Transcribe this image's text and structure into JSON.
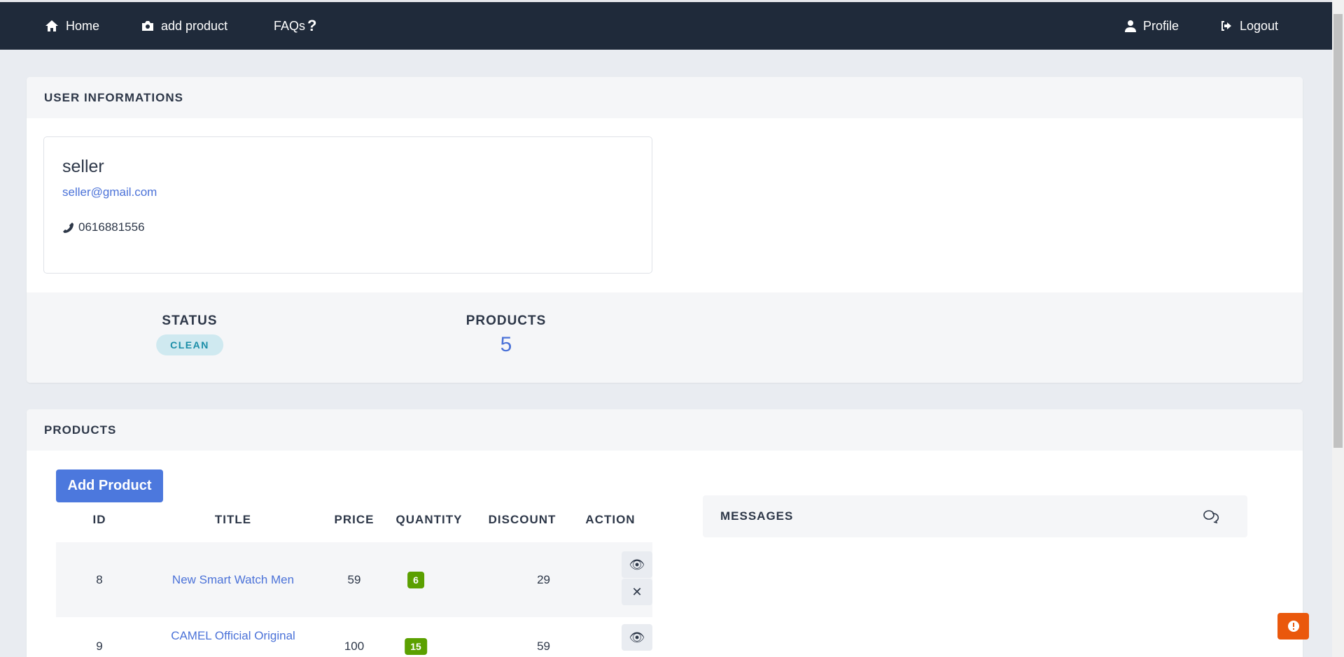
{
  "nav": {
    "home": "Home",
    "add_product": "add product",
    "faqs": "FAQs",
    "profile": "Profile",
    "logout": "Logout"
  },
  "user_card": {
    "title": "USER INFORMATIONS",
    "name": "seller",
    "email": "seller@gmail.com",
    "phone": "0616881556",
    "status_label": "STATUS",
    "status_value": "CLEAN",
    "products_label": "PRODUCTS",
    "products_count": "5"
  },
  "products_card": {
    "title": "PRODUCTS",
    "add_button": "Add Product",
    "columns": [
      "ID",
      "TITLE",
      "PRICE",
      "QUANTITY",
      "DISCOUNT",
      "ACTION"
    ],
    "rows": [
      {
        "id": "8",
        "title": "New Smart Watch Men",
        "price": "59",
        "quantity": "6",
        "discount": "29"
      },
      {
        "id": "9",
        "title": "CAMEL Official Original",
        "price": "100",
        "quantity": "15",
        "discount": "59"
      }
    ],
    "messages_title": "MESSAGES"
  },
  "colors": {
    "navbar": "#1f2a3a",
    "accent": "#4c78dd",
    "quantity_badge": "#5ba000",
    "alert": "#ea580c"
  }
}
